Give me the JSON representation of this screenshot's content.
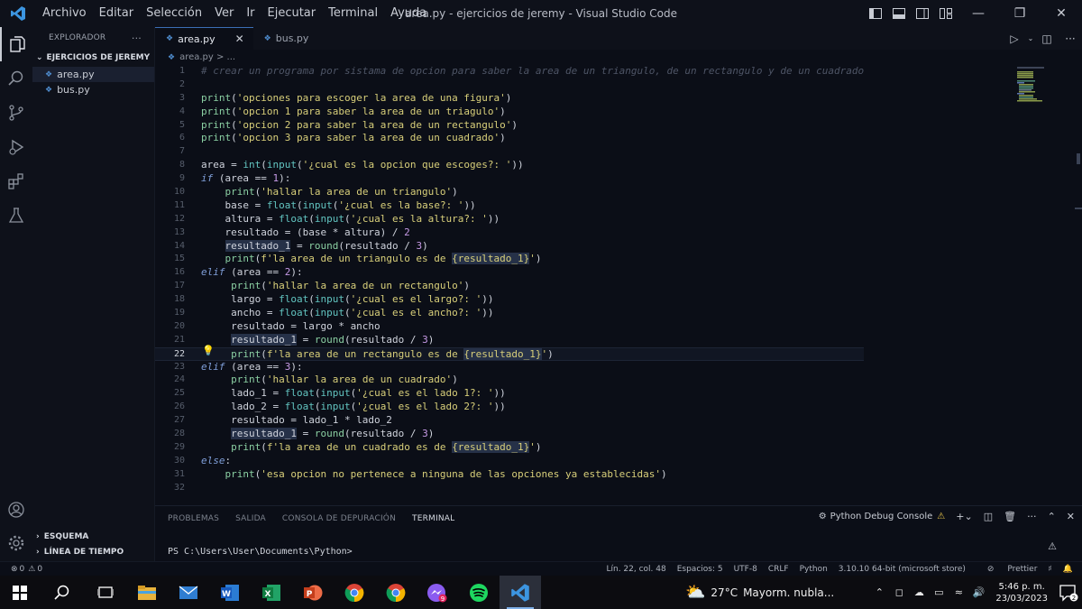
{
  "window": {
    "title": "area.py - ejercicios de jeremy - Visual Studio Code",
    "menu": [
      "Archivo",
      "Editar",
      "Selección",
      "Ver",
      "Ir",
      "Ejecutar",
      "Terminal",
      "Ayuda"
    ]
  },
  "sidebar": {
    "header": "EXPLORADOR",
    "more": "···",
    "folder": "EJERCICIOS DE JEREMY",
    "files": [
      "area.py",
      "bus.py"
    ],
    "outline": "ESQUEMA",
    "timeline": "LÍNEA DE TIEMPO"
  },
  "tabs": [
    {
      "label": "area.py",
      "close": "✕"
    },
    {
      "label": "bus.py"
    }
  ],
  "breadcrumb": "area.py > ...",
  "editor": {
    "current_line": 22,
    "lines": [
      "# crear un programa por sistama de opcion para saber la area de un triangulo, de un rectangulo y de un cuadrado",
      "",
      "print('opciones para escoger la area de una figura')",
      "print('opcion 1 para saber la area de un triagulo')",
      "print('opcion 2 para saber la area de un rectangulo')",
      "print('opcion 3 para saber la area de un cuadrado')",
      "",
      "area = int(input('¿cual es la opcion que escoges?: '))",
      "if (area == 1):",
      "    print('hallar la area de un triangulo')",
      "    base = float(input('¿cual es la base?: '))",
      "    altura = float(input('¿cual es la altura?: '))",
      "    resultado = (base * altura) / 2",
      "    resultado_1 = round(resultado / 3)",
      "    print(f'la area de un triangulo es de {resultado_1}')",
      "elif (area == 2):",
      "     print('hallar la area de un rectangulo')",
      "     largo = float(input('¿cual es el largo?: '))",
      "     ancho = float(input('¿cual es el ancho?: '))",
      "     resultado = largo * ancho",
      "     resultado_1 = round(resultado / 3)",
      "     print(f'la area de un rectangulo es de {resultado_1}')",
      "elif (area == 3):",
      "     print('hallar la area de un cuadrado')",
      "     lado_1 = float(input('¿cual es el lado 1?: '))",
      "     lado_2 = float(input('¿cual es el lado 2?: '))",
      "     resultado = lado_1 * lado_2",
      "     resultado_1 = round(resultado / 3)",
      "     print(f'la area de un cuadrado es de {resultado_1}')",
      "else:",
      "    print('esa opcion no pertenece a ninguna de las opciones ya establecidas')",
      ""
    ]
  },
  "panel": {
    "tabs": [
      "PROBLEMAS",
      "SALIDA",
      "CONSOLA DE DEPURACIÓN",
      "TERMINAL"
    ],
    "active_tab": "TERMINAL",
    "debug_console": "Python Debug Console",
    "prompt": "PS C:\\Users\\User\\Documents\\Python>"
  },
  "statusbar": {
    "errors": "0",
    "warnings": "0",
    "position": "Lín. 22, col. 48",
    "spaces": "Espacios: 5",
    "encoding": "UTF-8",
    "eol": "CRLF",
    "language": "Python",
    "interpreter": "3.10.10 64-bit (microsoft store)",
    "prettier": "Prettier"
  },
  "taskbar": {
    "weather_temp": "27°C",
    "weather_text": "Mayorm. nubla...",
    "time": "5:46 p. m.",
    "date": "23/03/2023",
    "notifications": "2",
    "badge_count": "9"
  },
  "colors": {
    "accent": "#3b6fb6",
    "keyword": "#7f9ed8",
    "string": "#d8cf7a",
    "function": "#8bd0a3",
    "number": "#c69ae6"
  }
}
